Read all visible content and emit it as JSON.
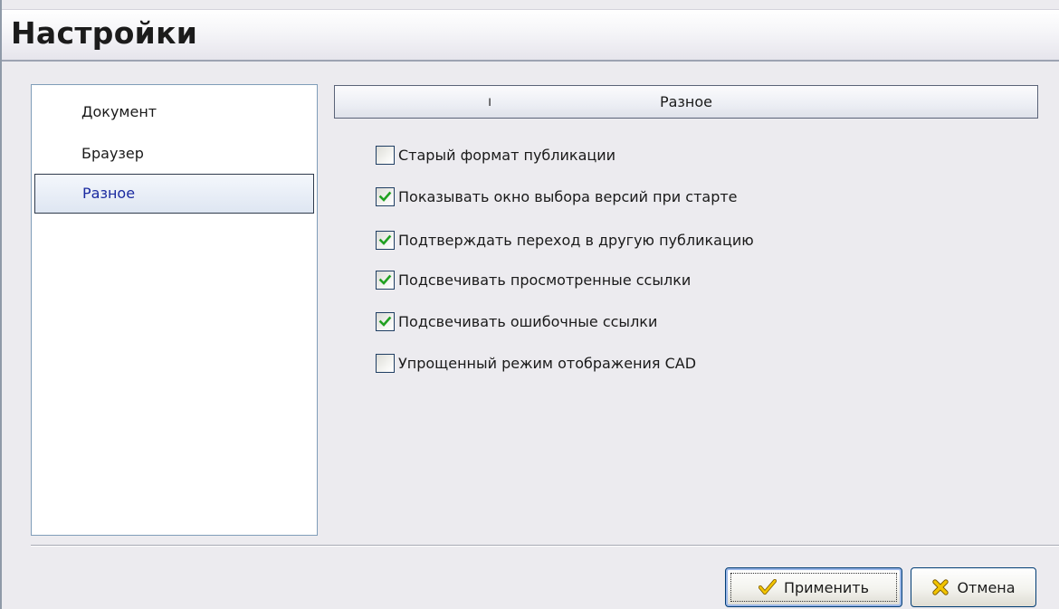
{
  "window": {
    "title": "Настройки"
  },
  "sidebar": {
    "items": [
      {
        "label": "Документ",
        "selected": false
      },
      {
        "label": "Браузер",
        "selected": false
      },
      {
        "label": "Разное",
        "selected": true
      }
    ]
  },
  "section": {
    "header_mark": "ı",
    "header_label": "Разное"
  },
  "options": [
    {
      "label": "Старый формат публикации",
      "checked": false
    },
    {
      "label": "Показывать окно выбора версий при старте",
      "checked": true
    },
    {
      "label": "Подтверждать переход в другую публикацию",
      "checked": true
    },
    {
      "label": "Подсвечивать просмотренные ссылки",
      "checked": true
    },
    {
      "label": "Подсвечивать ошибочные ссылки",
      "checked": true
    },
    {
      "label": "Упрощенный режим отображения CAD",
      "checked": false
    }
  ],
  "buttons": {
    "apply_label": "Применить",
    "apply_icon": "checkmark-icon",
    "cancel_label": "Отмена",
    "cancel_icon": "cross-icon"
  },
  "colors": {
    "check_mark": "#21a121",
    "selected_text": "#1a2aa0",
    "apply_icon": "#d8a800",
    "cancel_icon": "#e0b000"
  }
}
